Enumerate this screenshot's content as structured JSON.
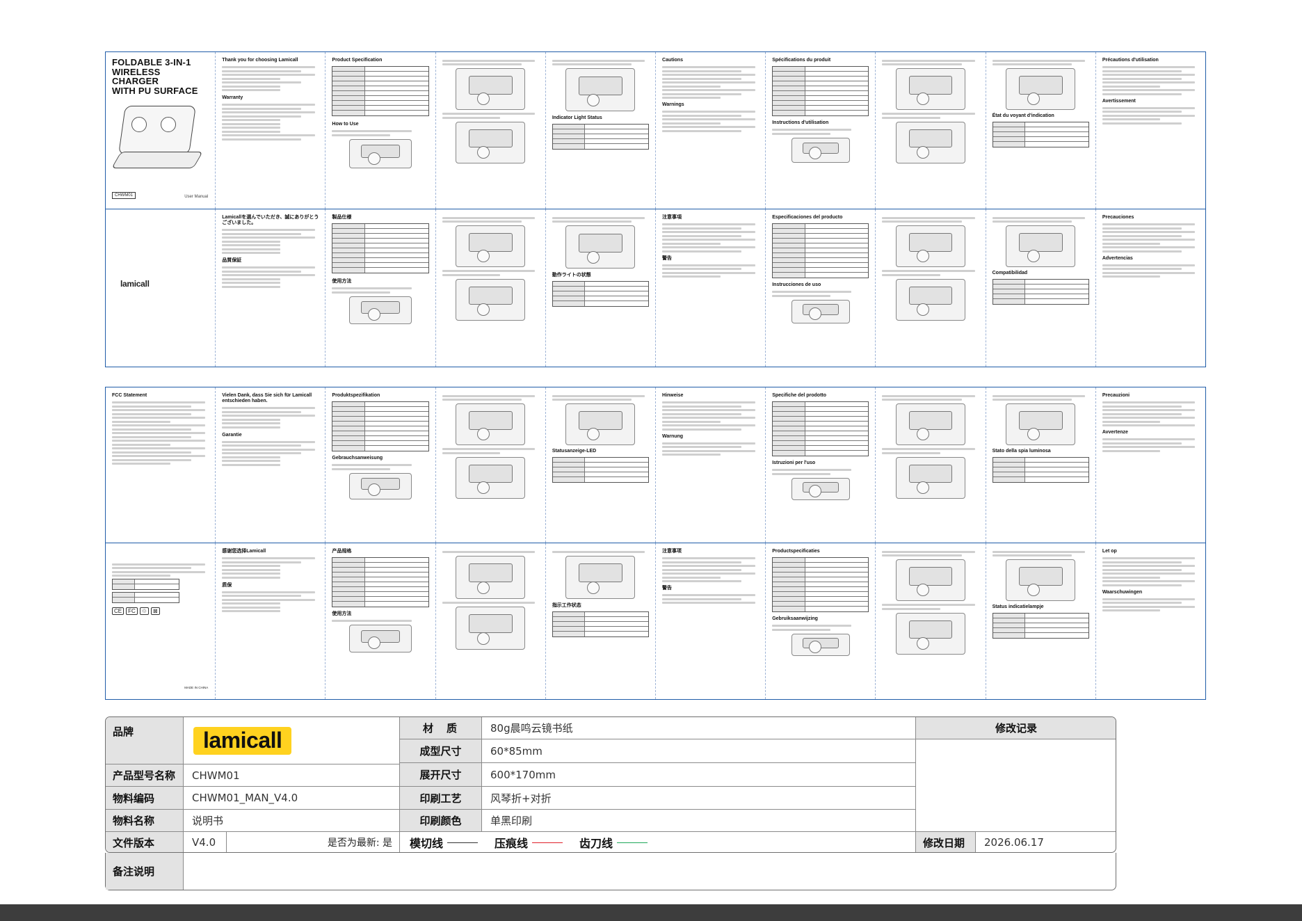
{
  "manual": {
    "cover": {
      "title_line1": "FOLDABLE 3-IN-1",
      "title_line2": "WIRELESS CHARGER",
      "title_line3": "WITH PU SURFACE",
      "model": "CHWM01",
      "doc_type": "User Manual",
      "brand": "lamicall"
    },
    "en": {
      "thanks": "Thank you for choosing Lamicall",
      "warranty": "Warranty",
      "spec": "Product Specification",
      "how_to_use": "How to Use",
      "cautions": "Cautions",
      "warnings": "Warnings",
      "indicator": "Indicator Light Status",
      "fcc": "FCC Statement"
    },
    "fr": {
      "spec": "Spécifications du produit",
      "instructions": "Instructions d'utilisation",
      "indicator": "État du voyant d'indication",
      "precautions": "Précautions d'utilisation",
      "warning": "Avertissement"
    },
    "ja": {
      "thanks": "Lamicallを選んでいただき、誠にありがとうございました。",
      "spec": "製品仕様",
      "warranty": "品質保証",
      "usage": "使用方法",
      "light": "動作ライトの状態",
      "notes": "注意事項",
      "warning": "警告"
    },
    "es": {
      "spec": "Especificaciones del producto",
      "instructions": "Instrucciones de uso",
      "compat": "Compatibilidad",
      "precautions": "Precauciones",
      "warnings": "Advertencias"
    },
    "de": {
      "thanks": "Vielen Dank, dass Sie sich für Lamicall entschieden haben.",
      "spec": "Produktspezifikation",
      "warranty": "Garantie",
      "usage": "Gebrauchsanweisung",
      "status": "Statusanzeige-LED",
      "hints": "Hinweise",
      "warning": "Warnung"
    },
    "it": {
      "spec": "Specifiche del prodotto",
      "usage": "Istruzioni per l'uso",
      "status": "Stato della spia luminosa",
      "precautions": "Precauzioni",
      "warning": "Avvertenze"
    },
    "zh": {
      "thanks": "感谢您选择Lamicall",
      "spec": "产品规格",
      "warranty": "质保",
      "usage": "使用方法",
      "light": "指示工作状态",
      "notes": "注意事项",
      "warning": "警告"
    },
    "nl": {
      "spec": "Productspecificaties",
      "usage": "Gebruiksaanwijzing",
      "status": "Status indicatielampje",
      "attention": "Let op",
      "warnings": "Waarschuwingen"
    },
    "made_in": "MADE IN CHINA"
  },
  "spec": {
    "brand_label": "品牌",
    "brand_logo": "lamicall",
    "model_label": "产品型号名称",
    "model_value": "CHWM01",
    "code_label": "物料编码",
    "code_value": "CHWM01_MAN_V4.0",
    "name_label": "物料名称",
    "name_value": "说明书",
    "version_label": "文件版本",
    "version_value": "V4.0",
    "latest": "是否为最新: 是",
    "note_label": "备注说明",
    "note_value": "",
    "material_label": "材　质",
    "material_value": "80g晨鸣云镜书纸",
    "size_label": "成型尺寸",
    "size_value": "60*85mm",
    "unfold_label": "展开尺寸",
    "unfold_value": "600*170mm",
    "craft_label": "印刷工艺",
    "craft_value": "风琴折+对折",
    "color_label": "印刷颜色",
    "color_value": "单黑印刷",
    "lines": [
      {
        "label": "模切线",
        "color": "#333333"
      },
      {
        "label": "压痕线",
        "color": "#e0202a"
      },
      {
        "label": "齿刀线",
        "color": "#1fa85a"
      }
    ],
    "revision_label": "修改记录",
    "revision_value": "",
    "date_label": "修改日期",
    "date_value": "2026.06.17"
  },
  "colors": {
    "sheet_border": "#1f5ca8",
    "logo_bg": "#ffd21f",
    "label_bg": "#e3e3e3"
  }
}
